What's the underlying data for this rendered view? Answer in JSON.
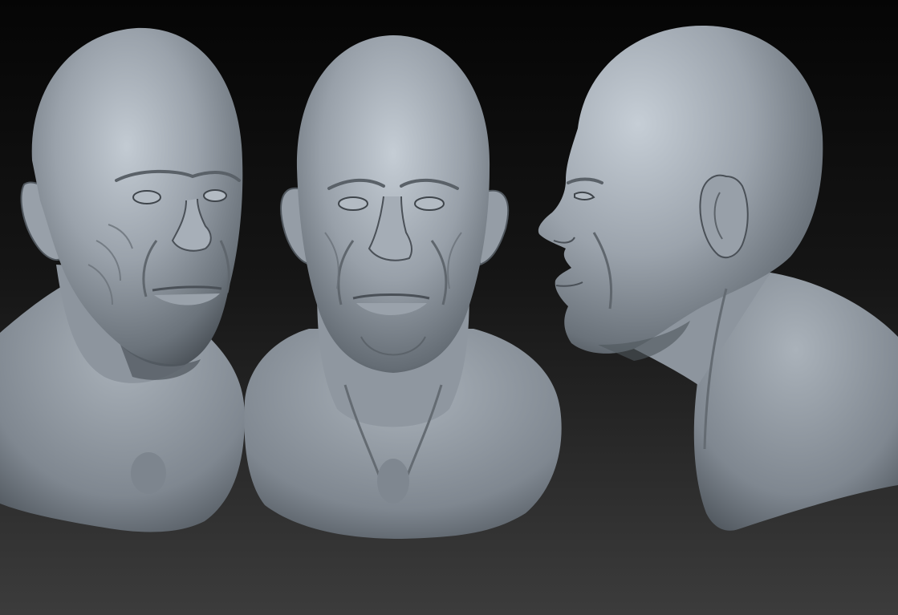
{
  "scene": {
    "background_top": "#050505",
    "background_bottom": "#3c3c3c",
    "material_highlight": "#c3cbd3",
    "material_mid": "#8b939c",
    "material_shadow": "#3f454b"
  },
  "views": [
    {
      "name": "three-quarter"
    },
    {
      "name": "front"
    },
    {
      "name": "side"
    }
  ]
}
